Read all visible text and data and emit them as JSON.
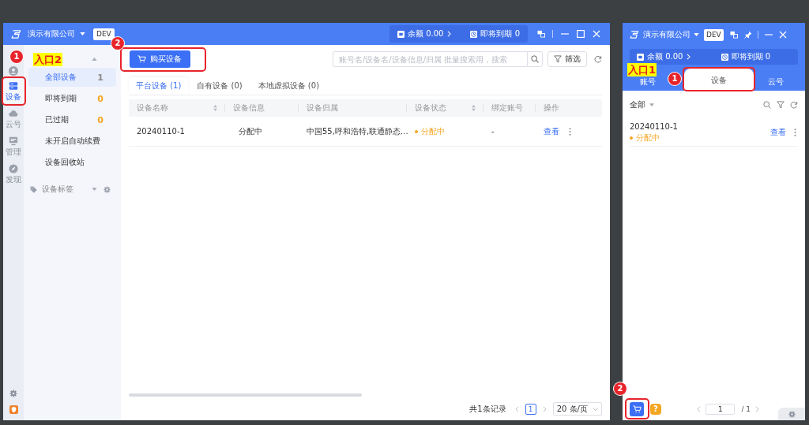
{
  "left_window": {
    "header": {
      "company": "演示有限公司",
      "env": "DEV",
      "balance": "余额 0.00",
      "expiring": "即将到期 0"
    },
    "rail": [
      {
        "kind": "account",
        "selected": false
      },
      {
        "kind": "device",
        "label": "设备",
        "selected": true,
        "callout": "1"
      },
      {
        "kind": "cloud",
        "label": "云号",
        "selected": false
      },
      {
        "kind": "manage",
        "label": "管理",
        "selected": false
      },
      {
        "kind": "discover",
        "label": "发现",
        "selected": false
      }
    ],
    "sidebar": {
      "entry_label": "入口2",
      "items": [
        {
          "label": "全部设备",
          "count": "1",
          "color": "#8c8c8c",
          "selected": true
        },
        {
          "label": "即将到期",
          "count": "0",
          "color": "#f5a623",
          "selected": false
        },
        {
          "label": "已过期",
          "count": "0",
          "color": "#f5a623",
          "selected": false
        },
        {
          "label": "未开启自动续费",
          "selected": false
        },
        {
          "label": "设备回收站",
          "selected": false
        }
      ],
      "tags_label": "设备标签"
    },
    "toolbar": {
      "buy_button": {
        "label": "购买设备",
        "callout": "2"
      },
      "search": {
        "placeholder": "账号名/设备名/设备信息/归属 批量搜索用，搜索"
      },
      "filter_button": "筛选"
    },
    "tabs": [
      {
        "label": "平台设备 (1)",
        "selected": true
      },
      {
        "label": "自有设备 (0)",
        "selected": false
      },
      {
        "label": "本地虚拟设备 (0)",
        "selected": false
      }
    ],
    "table": {
      "columns": [
        {
          "label": "设备名称",
          "sortable": true
        },
        {
          "label": "设备信息",
          "sortable": false
        },
        {
          "label": "设备归属",
          "sortable": false
        },
        {
          "label": "设备状态",
          "sortable": true
        },
        {
          "label": "绑定账号",
          "sortable": false
        },
        {
          "label": "操作",
          "sortable": false
        }
      ],
      "rows": [
        {
          "name": "20240110-1",
          "info": "分配中",
          "location": "中国55,呼和浩特,联通静态...",
          "status": {
            "text": "分配中",
            "color": "#f5a623"
          },
          "account": "-",
          "action": "查看"
        }
      ]
    },
    "pagination": {
      "summary": "共1条记录",
      "page": "1",
      "page_size": "20 条/页"
    }
  },
  "right_window": {
    "header": {
      "company": "演示有限公司",
      "env": "DEV",
      "balance": "余额 0.00",
      "expiring": "即将到期 0"
    },
    "entry_label": "入口1",
    "tabs": [
      {
        "label": "账号",
        "selected": false
      },
      {
        "label": "设备",
        "selected": true,
        "callout": "1"
      },
      {
        "label": "云号",
        "selected": false
      }
    ],
    "filter": "全部",
    "items": [
      {
        "name": "20240110-1",
        "status": "分配中",
        "color": "#f5a623",
        "action": "查看"
      }
    ],
    "footer": {
      "cart_callout": "2",
      "help": "?",
      "page": "1",
      "total": "/ 1"
    }
  }
}
